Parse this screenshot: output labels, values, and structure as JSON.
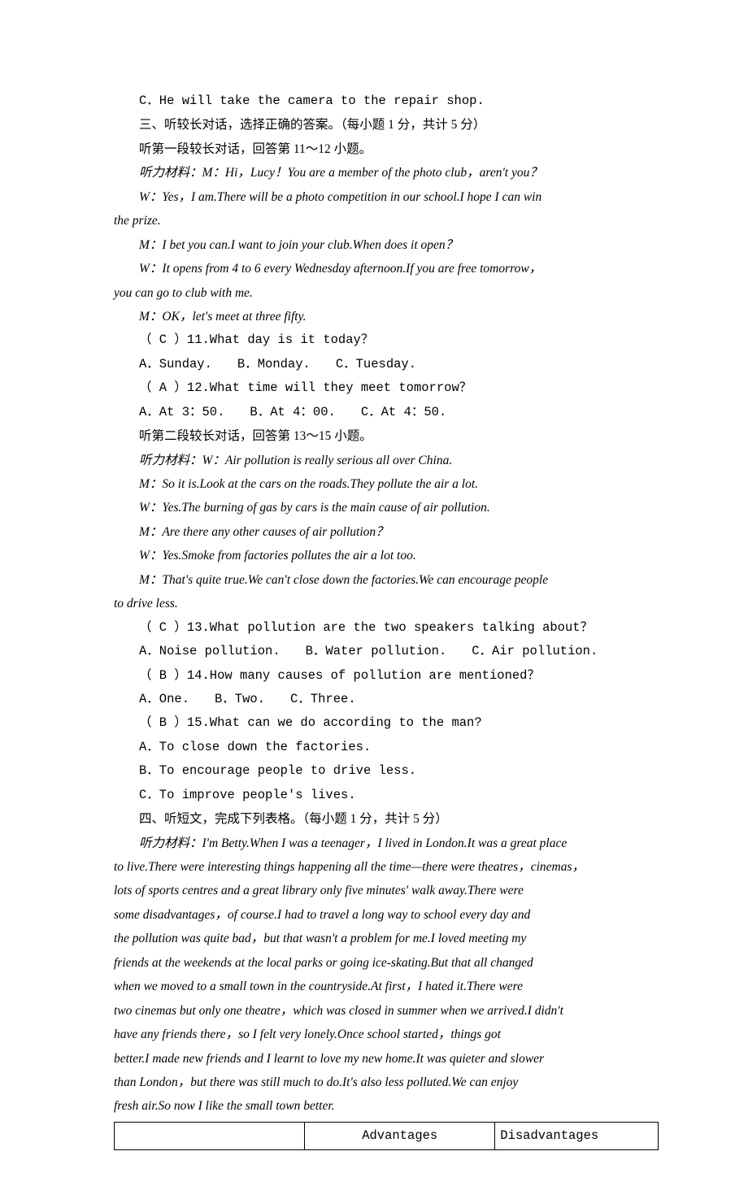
{
  "body": {
    "line0": "C．He will take the camera to the repair shop.",
    "sec3_title": "三、听较长对话，选择正确的答案。（每小题 1 分，共计 5 分）",
    "sec3_sub1": "听第一段较长对话，回答第 11～12 小题。",
    "d1_l1": "听力材料：M：Hi，Lucy！You are a member of the photo club，aren't you？",
    "d1_l2": "W：Yes，I am.There will be a photo competition in our school.I hope I can win",
    "d1_l2b": "the prize.",
    "d1_l3": "M：I bet you can.I want to join your club.When does it open？",
    "d1_l4": "W：It opens from 4 to 6 every Wednesday afternoon.If you are free tomorrow，",
    "d1_l4b": "you can go to club with me.",
    "d1_l5": "M：OK，let's meet at three fifty.",
    "q11": "（ C ）11.What day is it today？",
    "q11_opts": "A．Sunday.　　B．Monday.　　C．Tuesday.",
    "q12": "（ A ）12.What time will they meet tomorrow？",
    "q12_opts": "A．At 3：50.　　B．At 4：00.　　C．At 4：50.",
    "sec3_sub2": "听第二段较长对话，回答第 13～15 小题。",
    "d2_l1": "听力材料：W：Air pollution is really serious all over China.",
    "d2_l2": "M：So it is.Look at the cars on the roads.They pollute the air a lot.",
    "d2_l3": "W：Yes.The burning of gas by cars is the main cause of air pollution.",
    "d2_l4": "M：Are there any other causes of air pollution？",
    "d2_l5": "W：Yes.Smoke from factories pollutes the air a lot too.",
    "d2_l6": "M：That's quite true.We can't close down the factories.We can encourage people",
    "d2_l6b": "to drive less.",
    "q13": "（ C ）13.What pollution are the two speakers talking about？",
    "q13_opts": "A．Noise pollution.　　B．Water pollution.　　C．Air pollution.",
    "q14": "（ B ）14.How many causes of pollution are mentioned？",
    "q14_opts": "A．One.　　B．Two.　　C．Three.",
    "q15": "（ B ）15.What can we do according to the man?",
    "q15_a": "A．To close down the factories.",
    "q15_b": "B．To encourage people to drive less.",
    "q15_c": "C．To improve people's lives.",
    "sec4_title": "四、听短文，完成下列表格。（每小题 1 分，共计 5 分）",
    "p_l1": "听力材料：I'm Betty.When I was a teenager，I lived in London.It was a great place",
    "p_l2": "to live.There were interesting things happening all the time—there were theatres，cinemas，",
    "p_l3": "lots of sports centres and a great library only five minutes' walk away.There were",
    "p_l4": "some disadvantages，of course.I had to travel a long way to school every day and",
    "p_l5": "the pollution was quite bad，but that wasn't a problem for me.I loved meeting my",
    "p_l6": "friends at the weekends at the local parks or going ice-skating.But that all changed",
    "p_l7": "when we moved to a small town in the countryside.At first，I hated it.There were",
    "p_l8": "two cinemas but only one theatre，which was closed in summer when we arrived.I didn't",
    "p_l9": "have any friends there，so I felt very lonely.Once school started，things got",
    "p_l10": "better.I made new friends and I learnt to love my new home.It was quieter and slower",
    "p_l11": "than London，but there was still much to do.It's also less polluted.We can enjoy",
    "p_l12": "fresh air.So now I like the small town better."
  },
  "table": {
    "h1": "",
    "h2": "Advantages",
    "h3": "Disadvantages"
  }
}
